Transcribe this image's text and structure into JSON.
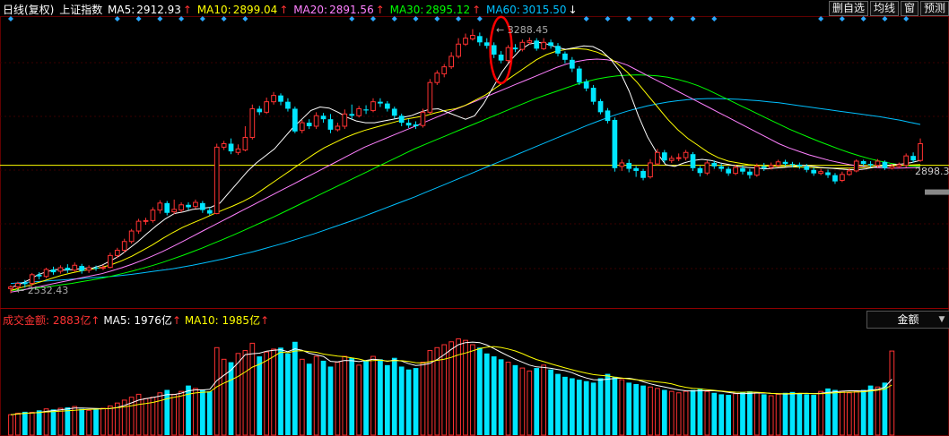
{
  "header": {
    "period": "日线(复权)",
    "index_name": "上证指数",
    "ma5_label": "MA5:",
    "ma5_value": "2912.93",
    "ma5_arrow": "↑",
    "ma10_label": "MA10:",
    "ma10_value": "2899.04",
    "ma10_arrow": "↑",
    "ma20_label": "MA20:",
    "ma20_value": "2891.56",
    "ma20_arrow": "↑",
    "ma30_label": "MA30:",
    "ma30_value": "2895.12",
    "ma30_arrow": "↑",
    "ma60_label": "MA60:",
    "ma60_value": "3015.50",
    "ma60_arrow": "↓"
  },
  "buttons": {
    "delete_watch": "删自选",
    "avg_line": "均线",
    "window": "窗",
    "forecast": "预测"
  },
  "volume_header": {
    "amount_label": "成交金额:",
    "amount_value": "2883亿",
    "amount_arrow": "↑",
    "ma5_label": "MA5:",
    "ma5_value": "1976亿",
    "ma5_arrow": "↑",
    "ma10_label": "MA10:",
    "ma10_value": "1985亿",
    "ma10_arrow": "↑"
  },
  "amount_selector": "金额",
  "annotations": {
    "high": "3288.45",
    "low": "2532.43",
    "last_price": "2898.3"
  },
  "colors": {
    "up": "#ff3232",
    "down": "#00e6ff",
    "ma5": "#ffffff",
    "ma10": "#ffff00",
    "ma20": "#ff80ff",
    "ma30": "#00ff00",
    "ma60": "#00c0ff",
    "marker": "#2aa8ff",
    "hline": "#ffff00",
    "circle": "#ff0000"
  },
  "chart_data": {
    "type": "candlestick",
    "ylim": [
      2500,
      3320
    ],
    "reference_level": 2898.3,
    "highlight_index": 69,
    "candles": [
      [
        2545,
        2550,
        2532,
        2555
      ],
      [
        2550,
        2560,
        2540,
        2565
      ],
      [
        2562,
        2558,
        2548,
        2570
      ],
      [
        2560,
        2585,
        2552,
        2590
      ],
      [
        2585,
        2580,
        2572,
        2592
      ],
      [
        2580,
        2600,
        2575,
        2605
      ],
      [
        2600,
        2592,
        2585,
        2608
      ],
      [
        2595,
        2605,
        2588,
        2612
      ],
      [
        2605,
        2598,
        2590,
        2615
      ],
      [
        2598,
        2612,
        2594,
        2620
      ],
      [
        2610,
        2596,
        2588,
        2616
      ],
      [
        2598,
        2605,
        2590,
        2612
      ],
      [
        2605,
        2603,
        2596,
        2611
      ],
      [
        2604,
        2606,
        2598,
        2613
      ],
      [
        2606,
        2640,
        2603,
        2648
      ],
      [
        2640,
        2655,
        2632,
        2662
      ],
      [
        2655,
        2680,
        2648,
        2688
      ],
      [
        2680,
        2710,
        2674,
        2716
      ],
      [
        2710,
        2738,
        2702,
        2745
      ],
      [
        2738,
        2740,
        2728,
        2748
      ],
      [
        2740,
        2770,
        2734,
        2778
      ],
      [
        2770,
        2790,
        2760,
        2798
      ],
      [
        2790,
        2762,
        2755,
        2796
      ],
      [
        2765,
        2772,
        2758,
        2800
      ],
      [
        2770,
        2785,
        2764,
        2792
      ],
      [
        2785,
        2778,
        2770,
        2792
      ],
      [
        2780,
        2792,
        2774,
        2800
      ],
      [
        2790,
        2770,
        2762,
        2796
      ],
      [
        2770,
        2760,
        2755,
        2778
      ],
      [
        2760,
        2950,
        2758,
        2960
      ],
      [
        2950,
        2960,
        2942,
        2968
      ],
      [
        2960,
        2938,
        2930,
        2975
      ],
      [
        2935,
        2945,
        2928,
        2958
      ],
      [
        2942,
        2978,
        2938,
        3010
      ],
      [
        2978,
        3060,
        2972,
        3072
      ],
      [
        3060,
        3050,
        3042,
        3068
      ],
      [
        3050,
        3080,
        3045,
        3092
      ],
      [
        3080,
        3098,
        3072,
        3108
      ],
      [
        3098,
        3080,
        3070,
        3104
      ],
      [
        3080,
        3060,
        3052,
        3090
      ],
      [
        3060,
        2995,
        2990,
        3066
      ],
      [
        2998,
        3020,
        2990,
        3028
      ],
      [
        3020,
        3010,
        3002,
        3030
      ],
      [
        3010,
        3040,
        3002,
        3050
      ],
      [
        3040,
        3030,
        3020,
        3048
      ],
      [
        3030,
        3000,
        2990,
        3045
      ],
      [
        3000,
        3010,
        2995,
        3020
      ],
      [
        3010,
        3045,
        3002,
        3058
      ],
      [
        3045,
        3040,
        3030,
        3072
      ],
      [
        3040,
        3060,
        3035,
        3068
      ],
      [
        3058,
        3055,
        3045,
        3070
      ],
      [
        3055,
        3080,
        3050,
        3090
      ],
      [
        3080,
        3075,
        3065,
        3090
      ],
      [
        3075,
        3060,
        3052,
        3082
      ],
      [
        3060,
        3040,
        3032,
        3066
      ],
      [
        3040,
        3020,
        3010,
        3046
      ],
      [
        3020,
        3012,
        3005,
        3030
      ],
      [
        3015,
        3010,
        3002,
        3024
      ],
      [
        3012,
        3050,
        3006,
        3060
      ],
      [
        3050,
        3135,
        3044,
        3145
      ],
      [
        3135,
        3162,
        3128,
        3170
      ],
      [
        3160,
        3180,
        3150,
        3188
      ],
      [
        3180,
        3210,
        3174,
        3222
      ],
      [
        3210,
        3245,
        3204,
        3262
      ],
      [
        3245,
        3262,
        3240,
        3275
      ],
      [
        3260,
        3270,
        3255,
        3288
      ],
      [
        3268,
        3250,
        3240,
        3278
      ],
      [
        3250,
        3240,
        3232,
        3262
      ],
      [
        3242,
        3215,
        3205,
        3250
      ],
      [
        3215,
        3198,
        3190,
        3225
      ],
      [
        3198,
        3235,
        3192,
        3242
      ],
      [
        3235,
        3230,
        3222,
        3245
      ],
      [
        3230,
        3250,
        3224,
        3258
      ],
      [
        3250,
        3255,
        3244,
        3264
      ],
      [
        3255,
        3232,
        3226,
        3262
      ],
      [
        3232,
        3250,
        3228,
        3262
      ],
      [
        3250,
        3240,
        3232,
        3258
      ],
      [
        3240,
        3218,
        3210,
        3248
      ],
      [
        3218,
        3200,
        3190,
        3224
      ],
      [
        3200,
        3175,
        3165,
        3208
      ],
      [
        3175,
        3135,
        3128,
        3182
      ],
      [
        3138,
        3118,
        3110,
        3145
      ],
      [
        3120,
        3080,
        3072,
        3128
      ],
      [
        3082,
        3050,
        3044,
        3088
      ],
      [
        3055,
        3025,
        3018,
        3062
      ],
      [
        3028,
        2890,
        2880,
        3035
      ],
      [
        2895,
        2905,
        2882,
        2915
      ],
      [
        2905,
        2888,
        2878,
        2915
      ],
      [
        2890,
        2882,
        2865,
        2896
      ],
      [
        2882,
        2862,
        2855,
        2888
      ],
      [
        2865,
        2905,
        2860,
        2916
      ],
      [
        2902,
        2935,
        2898,
        2945
      ],
      [
        2935,
        2912,
        2905,
        2942
      ],
      [
        2912,
        2918,
        2905,
        2926
      ],
      [
        2918,
        2920,
        2910,
        2932
      ],
      [
        2920,
        2935,
        2912,
        2942
      ],
      [
        2930,
        2890,
        2882,
        2936
      ],
      [
        2890,
        2876,
        2866,
        2896
      ],
      [
        2876,
        2905,
        2870,
        2912
      ],
      [
        2905,
        2895,
        2888,
        2912
      ],
      [
        2895,
        2888,
        2880,
        2902
      ],
      [
        2888,
        2875,
        2868,
        2894
      ],
      [
        2875,
        2892,
        2870,
        2900
      ],
      [
        2890,
        2880,
        2872,
        2898
      ],
      [
        2880,
        2870,
        2860,
        2888
      ],
      [
        2870,
        2895,
        2865,
        2903
      ],
      [
        2895,
        2890,
        2882,
        2905
      ],
      [
        2892,
        2898,
        2886,
        2906
      ],
      [
        2898,
        2908,
        2892,
        2914
      ],
      [
        2908,
        2902,
        2896,
        2914
      ],
      [
        2902,
        2900,
        2892,
        2908
      ],
      [
        2900,
        2895,
        2888,
        2906
      ],
      [
        2895,
        2885,
        2878,
        2902
      ],
      [
        2885,
        2875,
        2868,
        2892
      ],
      [
        2875,
        2880,
        2870,
        2888
      ],
      [
        2878,
        2870,
        2862,
        2886
      ],
      [
        2870,
        2852,
        2845,
        2876
      ],
      [
        2855,
        2872,
        2850,
        2880
      ],
      [
        2872,
        2882,
        2868,
        2890
      ],
      [
        2882,
        2910,
        2878,
        2915
      ],
      [
        2910,
        2902,
        2896,
        2914
      ],
      [
        2902,
        2898,
        2892,
        2910
      ],
      [
        2898,
        2910,
        2892,
        2916
      ],
      [
        2908,
        2890,
        2885,
        2912
      ],
      [
        2890,
        2895,
        2886,
        2902
      ],
      [
        2895,
        2900,
        2890,
        2906
      ],
      [
        2898,
        2925,
        2892,
        2932
      ],
      [
        2925,
        2912,
        2906,
        2935
      ],
      [
        2912,
        2960,
        2908,
        2975
      ]
    ],
    "ma5": [
      2548,
      2558,
      2570,
      2585,
      2594,
      2600,
      2598,
      2600,
      2603,
      2604,
      2612,
      2625,
      2640,
      2660,
      2680,
      2703,
      2725,
      2745,
      2760,
      2765,
      2772,
      2775,
      2778,
      2790,
      2820,
      2850,
      2880,
      2905,
      2925,
      2945,
      2975,
      3005,
      3030,
      3055,
      3065,
      3062,
      3050,
      3035,
      3025,
      3020,
      3020,
      3025,
      3030,
      3035,
      3040,
      3050,
      3058,
      3060,
      3050,
      3040,
      3030,
      3040,
      3075,
      3120,
      3165,
      3200,
      3228,
      3245,
      3250,
      3245,
      3236,
      3230,
      3235,
      3240,
      3238,
      3225,
      3200,
      3165,
      3110,
      3040,
      2980,
      2935,
      2900,
      2895,
      2905,
      2912,
      2915,
      2912,
      2905,
      2900,
      2895,
      2892,
      2890,
      2888,
      2890,
      2892,
      2895,
      2898,
      2896,
      2892,
      2890,
      2888,
      2886,
      2885,
      2888,
      2893,
      2897,
      2900,
      2902,
      2906,
      2912
    ],
    "ma10": [
      2540,
      2548,
      2556,
      2565,
      2574,
      2583,
      2590,
      2596,
      2601,
      2606,
      2614,
      2625,
      2638,
      2654,
      2670,
      2688,
      2705,
      2720,
      2733,
      2745,
      2758,
      2770,
      2782,
      2795,
      2810,
      2830,
      2850,
      2870,
      2890,
      2910,
      2930,
      2948,
      2962,
      2976,
      2988,
      2998,
      3006,
      3014,
      3022,
      3030,
      3035,
      3040,
      3048,
      3055,
      3060,
      3070,
      3085,
      3100,
      3120,
      3140,
      3160,
      3180,
      3200,
      3215,
      3225,
      3230,
      3232,
      3230,
      3222,
      3210,
      3190,
      3165,
      3135,
      3100,
      3065,
      3030,
      3000,
      2975,
      2955,
      2935,
      2920,
      2910,
      2905,
      2900,
      2898,
      2896,
      2895,
      2894,
      2893,
      2892,
      2891,
      2890,
      2890,
      2890,
      2891,
      2893,
      2895,
      2897,
      2898,
      2899,
      2900
    ],
    "ma20": [
      2535,
      2540,
      2546,
      2552,
      2558,
      2564,
      2570,
      2576,
      2582,
      2588,
      2596,
      2605,
      2615,
      2626,
      2638,
      2651,
      2665,
      2680,
      2695,
      2710,
      2725,
      2740,
      2755,
      2770,
      2785,
      2800,
      2815,
      2830,
      2845,
      2860,
      2875,
      2890,
      2905,
      2920,
      2935,
      2950,
      2962,
      2974,
      2986,
      2998,
      3010,
      3022,
      3034,
      3046,
      3058,
      3070,
      3082,
      3094,
      3106,
      3118,
      3130,
      3142,
      3154,
      3166,
      3178,
      3188,
      3195,
      3200,
      3202,
      3200,
      3195,
      3185,
      3170,
      3155,
      3140,
      3125,
      3110,
      3095,
      3080,
      3065,
      3050,
      3035,
      3020,
      3005,
      2990,
      2975,
      2960,
      2948,
      2938,
      2928,
      2920,
      2912,
      2906,
      2900,
      2896,
      2893,
      2891,
      2890,
      2890,
      2891,
      2892
    ],
    "ma30": [
      2540,
      2542,
      2545,
      2548,
      2552,
      2556,
      2560,
      2565,
      2570,
      2575,
      2581,
      2588,
      2595,
      2603,
      2611,
      2620,
      2630,
      2640,
      2651,
      2662,
      2674,
      2686,
      2698,
      2711,
      2724,
      2737,
      2750,
      2764,
      2778,
      2792,
      2806,
      2820,
      2834,
      2848,
      2862,
      2876,
      2890,
      2904,
      2918,
      2932,
      2946,
      2958,
      2970,
      2982,
      2994,
      3006,
      3018,
      3030,
      3042,
      3054,
      3066,
      3078,
      3090,
      3100,
      3110,
      3120,
      3130,
      3138,
      3145,
      3150,
      3154,
      3156,
      3157,
      3156,
      3154,
      3150,
      3144,
      3136,
      3126,
      3114,
      3100,
      3086,
      3072,
      3058,
      3044,
      3030,
      3016,
      3002,
      2990,
      2978,
      2966,
      2955,
      2944,
      2934,
      2925,
      2917,
      2910,
      2904,
      2899,
      2896,
      2895
    ],
    "ma60": [
      2560,
      2562,
      2564,
      2566,
      2568,
      2570,
      2572,
      2574,
      2576,
      2578,
      2580,
      2583,
      2586,
      2590,
      2594,
      2598,
      2602,
      2607,
      2612,
      2618,
      2624,
      2630,
      2637,
      2644,
      2651,
      2659,
      2667,
      2675,
      2684,
      2693,
      2702,
      2712,
      2722,
      2732,
      2742,
      2753,
      2764,
      2775,
      2786,
      2797,
      2808,
      2820,
      2832,
      2844,
      2856,
      2868,
      2880,
      2892,
      2904,
      2916,
      2928,
      2940,
      2952,
      2964,
      2976,
      2988,
      3000,
      3012,
      3023,
      3034,
      3044,
      3053,
      3061,
      3068,
      3074,
      3079,
      3083,
      3086,
      3088,
      3089,
      3089,
      3088,
      3087,
      3085,
      3083,
      3080,
      3077,
      3073,
      3069,
      3065,
      3061,
      3057,
      3053,
      3049,
      3045,
      3041,
      3037,
      3032,
      3027,
      3021,
      3015
    ],
    "volume": {
      "ylim": [
        0,
        3500
      ],
      "series": [
        700,
        750,
        800,
        780,
        850,
        900,
        880,
        920,
        950,
        980,
        900,
        850,
        880,
        920,
        1000,
        1100,
        1200,
        1300,
        1400,
        1250,
        1300,
        1450,
        1550,
        1400,
        1500,
        1700,
        1600,
        1550,
        1500,
        3000,
        2600,
        2500,
        2800,
        2900,
        3150,
        2700,
        2850,
        2950,
        3000,
        2800,
        3200,
        2600,
        2450,
        2700,
        2550,
        2350,
        2500,
        2700,
        2650,
        2400,
        2550,
        2700,
        2600,
        2400,
        2650,
        2350,
        2250,
        2300,
        2500,
        2900,
        3000,
        3100,
        3200,
        3300,
        3250,
        3100,
        3000,
        2800,
        2700,
        2600,
        2500,
        2400,
        2300,
        2200,
        2300,
        2400,
        2250,
        2100,
        2000,
        1950,
        1900,
        1850,
        1800,
        1950,
        2100,
        2000,
        1900,
        1800,
        1750,
        1700,
        1650,
        1600,
        1550,
        1500,
        1450,
        1500,
        1550,
        1600,
        1500,
        1450,
        1400,
        1380,
        1420,
        1460,
        1500,
        1450,
        1400,
        1350,
        1400,
        1450,
        1480,
        1420,
        1400,
        1380,
        1500,
        1600,
        1550,
        1500,
        1450,
        1500,
        1550,
        1700,
        1650,
        1800,
        2883
      ]
    }
  }
}
